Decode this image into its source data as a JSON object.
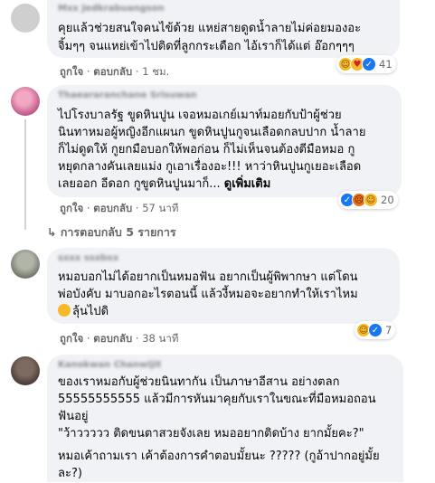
{
  "comments": [
    {
      "author": "Mxx Jedkrabuangson",
      "lines": [
        "คุยแล้วช่วยสนใจคนไข้ด้วย แหย่สายดูดน้ำลายไม่ค่อยมองอะ",
        "จิ้มๆๆ จนแหย่เข้าไปติดที่ลูกกระเดือก ไอ้เราก็ได้แต่ อ๊อกๆๆๆ"
      ],
      "like": "ถูกใจ",
      "reply": "ตอบกลับ",
      "time": "1 ชม.",
      "reaction_count": "41"
    },
    {
      "author": "Thaeararanchane Srisuwan",
      "lines": [
        "ไปโรงบาลรัฐ ขูดหินปูน เจอหมอเกย์เมาท์มอยกับป้าผู้ช่วย",
        "นินทาหมอผู้หญิงอีกแผนก ขูดหินปูนกูจนเลือดกลบปาก น้ำลาย",
        "ก็ไม่ดูดให้ กูยกมือบอกให้พอก่อน ก็ไม่เห็นจนต้องตีมือหมอ กู",
        "หยุดกลางคันเลยแม่ง กูเอาเรื่องอะ!!! หาว่าหินปูนกูเยอะเลือด",
        "เลยออก อีดอก กูขูดหินปูนมาก็..."
      ],
      "see_more": "ดูเพิ่มเติม",
      "like": "ถูกใจ",
      "reply": "ตอบกลับ",
      "time": "57 นาที",
      "reaction_count": "20",
      "replies_link": "การตอบกลับ 5 รายการ"
    },
    {
      "author": "sxxx ssxbxx",
      "lines": [
        "หมอบอกไม่ได้อยากเป็นหมอฟัน อยากเป็นผู้พิพากษา แต่โดน",
        "พ่อบังคับ มาบอกอะไรตอนนี้ แล้วงี้หมอจะอยากทำให้เราไหม",
        "ลุ้นไปดิ"
      ],
      "like": "ถูกใจ",
      "reply": "ตอบกลับ",
      "time": "38 นาที",
      "reaction_count": "7"
    },
    {
      "author": "Kanokwan Chanwijit",
      "lines": [
        "ของเราหมอกับผู้ช่วยนินทากัน เป็นภาษาอีสาน อย่างตลก",
        "55555555555 แล้วมีการหันมาคุยกับเราในขณะที่มือหมอถอน",
        "ฟันอยู่",
        "\"ว้าววววว ติดขนตาสวยจังเลย หมออยากติดบ้าง ยากมั้ยคะ?\"",
        "",
        "หมอเค้าถามเรา เค้าต้องการคำตอบมั้ยนะ ????? (กูอ้าปากอยู่มั้ย",
        "ละ?)"
      ]
    }
  ]
}
